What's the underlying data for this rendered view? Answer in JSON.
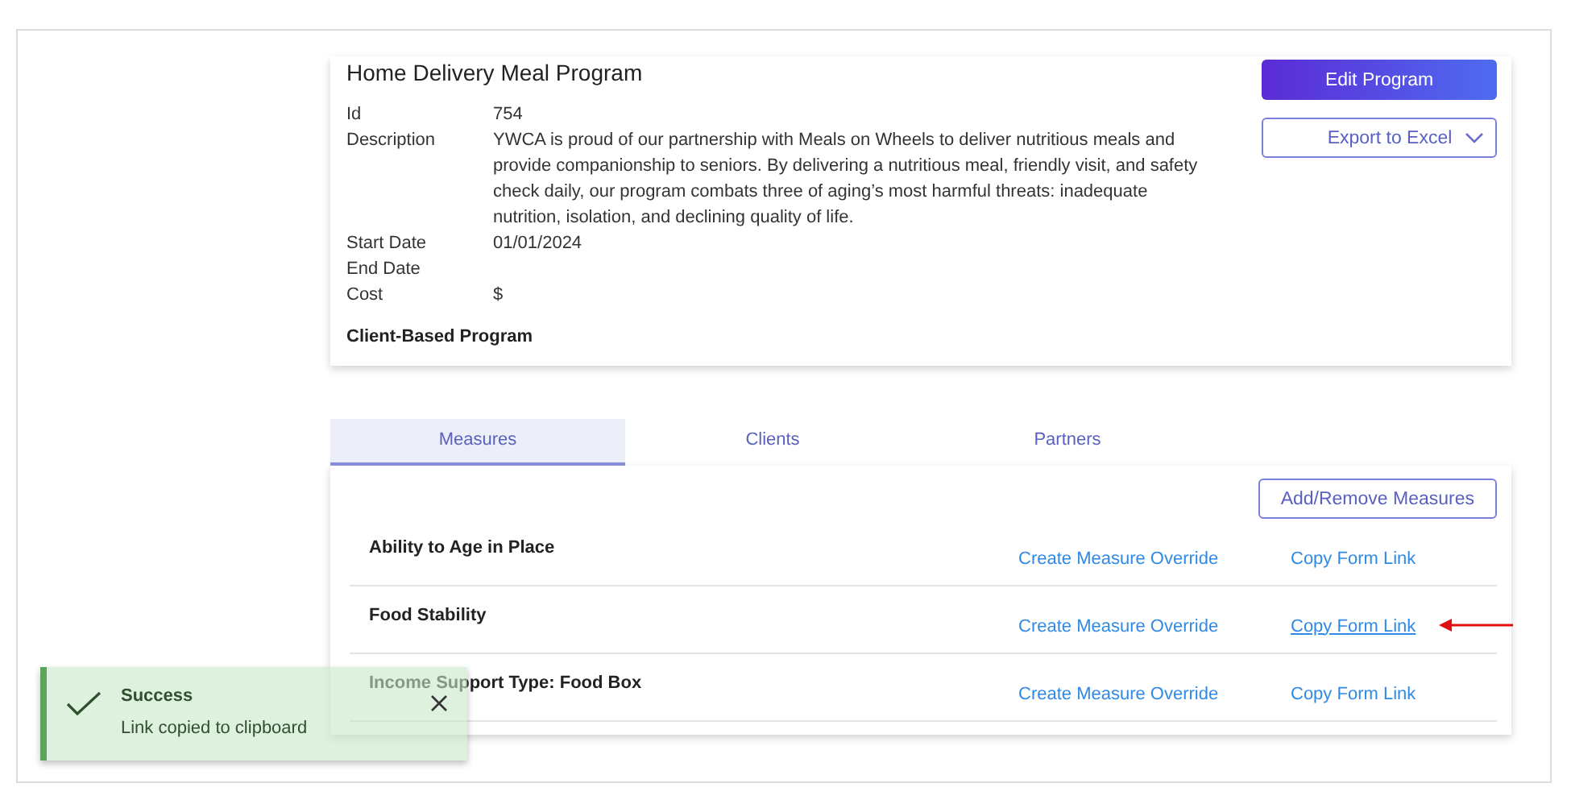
{
  "program": {
    "title": "Home Delivery Meal Program",
    "fields": [
      {
        "label": "Id",
        "value": "754"
      },
      {
        "label": "Description",
        "value": "YWCA is proud of our partnership with Meals on Wheels to deliver nutritious meals and provide companionship to seniors. By delivering a nutritious meal, friendly visit, and safety check daily, our program combats three of aging’s most harmful threats: inadequate nutrition, isolation, and declining quality of life."
      },
      {
        "label": "Start Date",
        "value": "01/01/2024"
      },
      {
        "label": "End Date"
      },
      {
        "label": "Cost",
        "value": "$"
      }
    ],
    "footer": "Client-Based Program"
  },
  "actions": {
    "edit": "Edit Program",
    "export": "Export to Excel"
  },
  "tabs": [
    {
      "label": "Measures",
      "selected": true
    },
    {
      "label": "Clients",
      "selected": false
    },
    {
      "label": "Partners",
      "selected": false
    }
  ],
  "add_remove": "Add/Remove Measures",
  "measures": [
    {
      "name": "Ability to Age in Place",
      "override": "Create Measure Override",
      "link": "Copy Form Link",
      "highlighted": false
    },
    {
      "name": "Food Stability",
      "override": "Create Measure Override",
      "link": "Copy Form Link",
      "highlighted": true
    },
    {
      "name": "Income Support Type: Food Box",
      "override": "Create Measure Override",
      "link": "Copy Form Link",
      "highlighted": false
    }
  ],
  "toast": {
    "title": "Success",
    "message": "Link copied to clipboard"
  }
}
